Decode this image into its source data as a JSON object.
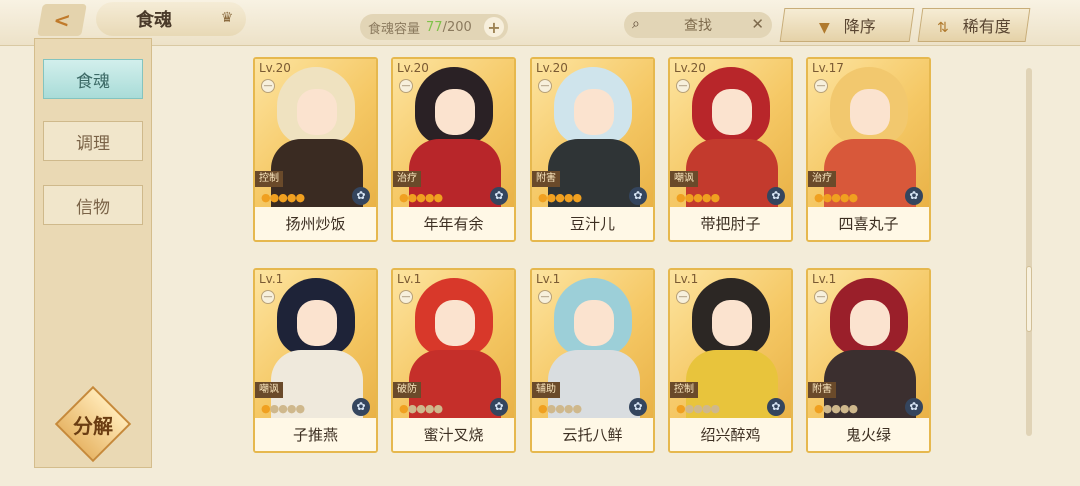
{
  "header": {
    "title": "食魂",
    "back_icon": "back-chevron-icon",
    "title_icon": "crown-icon",
    "capacity_label": "食魂容量",
    "capacity_current": "77",
    "capacity_max": "/200",
    "plus": "+",
    "search_placeholder": "查找",
    "search_icon": "🔍",
    "clear_icon": "✕",
    "sort_label": "降序",
    "sort_icon": "▼",
    "rarity_label": "稀有度",
    "rarity_icon": "⇅",
    "accent_color": "#7fc24a"
  },
  "sidebar": {
    "tabs": [
      {
        "label": "食魂",
        "active": true
      },
      {
        "label": "调理",
        "active": false
      },
      {
        "label": "信物",
        "active": false
      }
    ],
    "decompose_label": "分解"
  },
  "cards": [
    {
      "level": "Lv.20",
      "name": "扬州炒饭",
      "role": "控制",
      "stars": 5,
      "hair": "#efe2c0",
      "outfit": "#3a2b22"
    },
    {
      "level": "Lv.20",
      "name": "年年有余",
      "role": "治疗",
      "stars": 5,
      "hair": "#2a2125",
      "outfit": "#b8262a"
    },
    {
      "level": "Lv.20",
      "name": "豆汁儿",
      "role": "附害",
      "stars": 5,
      "hair": "#cfe4ec",
      "outfit": "#2f3436"
    },
    {
      "level": "Lv.20",
      "name": "带把肘子",
      "role": "嘲讽",
      "stars": 5,
      "hair": "#b8262a",
      "outfit": "#c33a2d"
    },
    {
      "level": "Lv.17",
      "name": "四喜丸子",
      "role": "治疗",
      "stars": 5,
      "hair": "#f2c86e",
      "outfit": "#d8583a"
    },
    {
      "level": "Lv.1",
      "name": "子推燕",
      "role": "嘲讽",
      "stars": 1,
      "hair": "#1e2338",
      "outfit": "#efe9dc"
    },
    {
      "level": "Lv.1",
      "name": "蜜汁叉烧",
      "role": "破防",
      "stars": 1,
      "hair": "#d8382a",
      "outfit": "#c52f2a"
    },
    {
      "level": "Lv.1",
      "name": "云托八鲜",
      "role": "辅助",
      "stars": 1,
      "hair": "#9ccfd8",
      "outfit": "#d9dde0"
    },
    {
      "level": "Lv.1",
      "name": "绍兴醉鸡",
      "role": "控制",
      "stars": 1,
      "hair": "#2c2724",
      "outfit": "#e8c43c"
    },
    {
      "level": "Lv.1",
      "name": "鬼火绿",
      "role": "附害",
      "stars": 1,
      "hair": "#9a1f2a",
      "outfit": "#3b2f2f"
    }
  ],
  "card_badge": "—",
  "medal_icon": "✿",
  "scroll_position": 0.54
}
